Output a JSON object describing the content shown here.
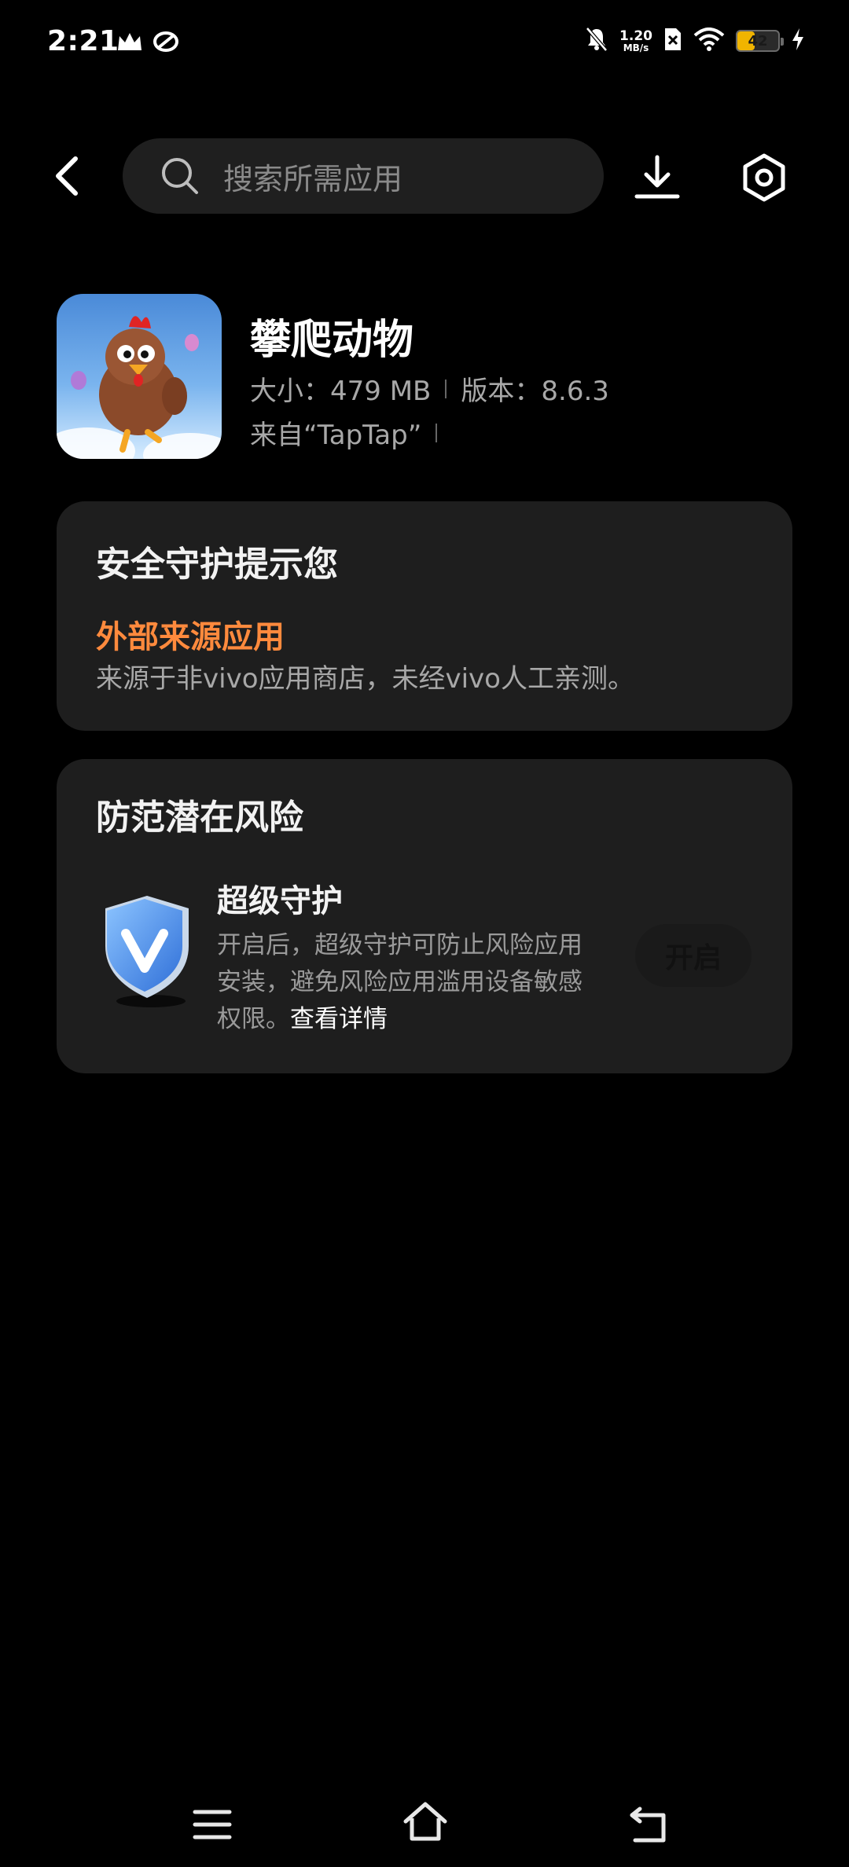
{
  "status_bar": {
    "time": "2:21",
    "net_speed_value": "1.20",
    "net_speed_unit": "MB/s",
    "battery_level": "42",
    "battery_fraction": 0.42,
    "left_icons": [
      "crown-icon",
      "app-logo-icon"
    ],
    "right_icons": [
      "mute-bell-icon",
      "no-sim-icon",
      "wifi-icon",
      "battery-icon",
      "charging-icon"
    ]
  },
  "topbar": {
    "search_placeholder": "搜索所需应用",
    "icons": [
      "back-arrow-icon",
      "search-icon",
      "download-icon",
      "settings-hex-icon"
    ]
  },
  "app": {
    "name": "攀爬动物",
    "size_label": "大小：479 MB",
    "version_label": "版本：8.6.3",
    "source_label": "来自“TapTap”"
  },
  "security_card": {
    "title": "安全守护提示您",
    "warning_title": "外部来源应用",
    "warning_desc": "来源于非vivo应用商店，未经vivo人工亲测。"
  },
  "risk_card": {
    "title": "防范潜在风险",
    "guard_title": "超级守护",
    "guard_desc": "开启后，超级守护可防止风险应用安装，避免风险应用滥用设备敏感权限。",
    "details_link": "查看详情",
    "enable_button": "开启"
  },
  "colors": {
    "background": "#000000",
    "card": "#1e1e1e",
    "warning": "#ff8a3d",
    "battery": "#f0b400"
  }
}
